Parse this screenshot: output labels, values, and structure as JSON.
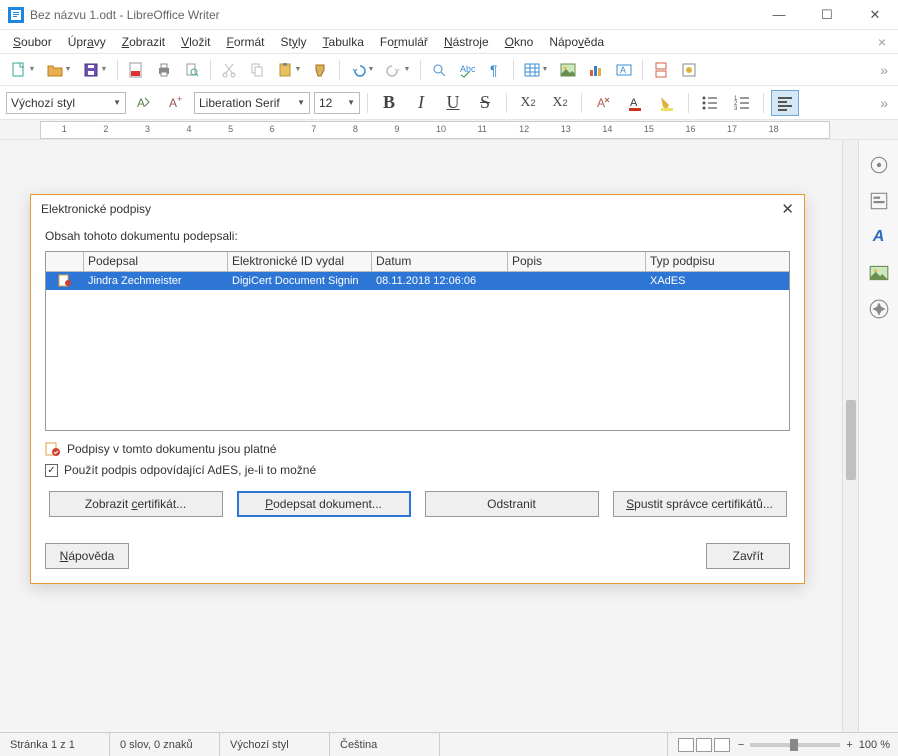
{
  "window": {
    "title": "Bez názvu 1.odt - LibreOffice Writer"
  },
  "menu": [
    "Soubor",
    "Úpravy",
    "Zobrazit",
    "Vložit",
    "Formát",
    "Styly",
    "Tabulka",
    "Formulář",
    "Nástroje",
    "Okno",
    "Nápověda"
  ],
  "toolbar": {
    "icons": [
      "new",
      "open",
      "save",
      "sep",
      "pdf",
      "print",
      "preview",
      "sep",
      "cut",
      "copy",
      "paste",
      "clone",
      "sep",
      "brush",
      "undo",
      "redo",
      "sep",
      "find",
      "spell",
      "pilcrow",
      "sep",
      "table",
      "image",
      "chart",
      "textbox",
      "sep",
      "pagebreak",
      "link",
      "comment",
      "sep"
    ]
  },
  "format": {
    "style": "Výchozí styl",
    "font": "Liberation Serif",
    "size": "12"
  },
  "ruler_numbers": [
    1,
    2,
    3,
    4,
    5,
    6,
    7,
    8,
    9,
    10,
    11,
    12,
    13,
    14,
    15,
    16,
    17,
    18
  ],
  "dialog": {
    "title": "Elektronické podpisy",
    "label": "Obsah tohoto dokumentu podepsali:",
    "columns": [
      "",
      "Podepsal",
      "Elektronické ID vydal",
      "Datum",
      "Popis",
      "Typ podpisu"
    ],
    "row": {
      "signer": "Jindra Zechmeister",
      "issuer": "DigiCert Document Signin",
      "date": "08.11.2018 12:06:06",
      "desc": "",
      "type": "XAdES"
    },
    "status": "Podpisy v tomto dokumentu jsou platné",
    "checkbox": "Použít podpis odpovídající AdES, je-li to možné",
    "btn_view": "Zobrazit certifikát...",
    "btn_sign": "Podepsat dokument...",
    "btn_remove": "Odstranit",
    "btn_mgr": "Spustit správce certifikátů...",
    "btn_help": "Nápověda",
    "btn_close": "Zavřít"
  },
  "statusbar": {
    "page": "Stránka 1 z 1",
    "words": "0 slov, 0 znaků",
    "style": "Výchozí styl",
    "lang": "Čeština",
    "zoom": "100 %"
  }
}
